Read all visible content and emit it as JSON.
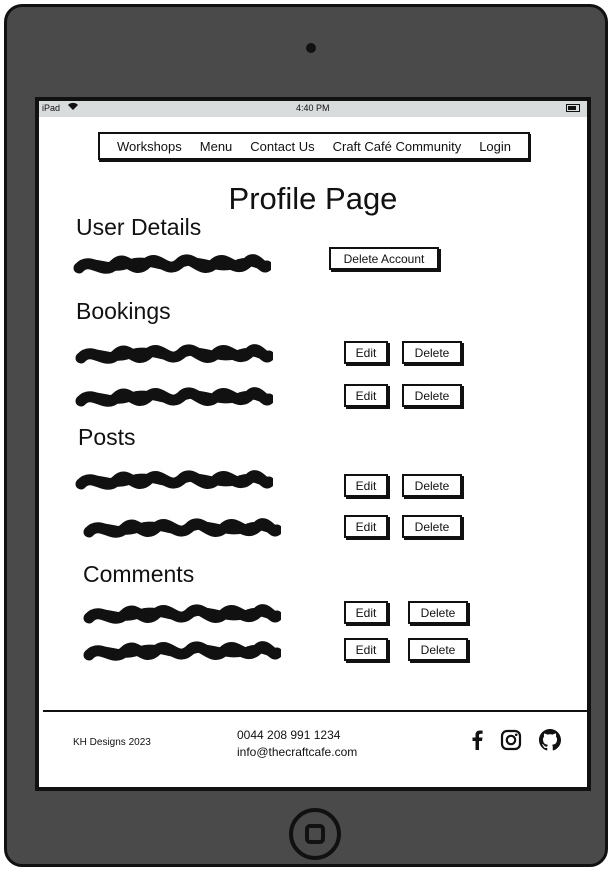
{
  "status_bar": {
    "carrier": "iPad",
    "time": "4:40 PM"
  },
  "nav": {
    "items": [
      "Workshops",
      "Menu",
      "Contact Us",
      "Craft Café Community",
      "Login"
    ]
  },
  "page": {
    "title": "Profile Page"
  },
  "user_details": {
    "heading": "User Details",
    "delete_account_label": "Delete Account"
  },
  "bookings": {
    "heading": "Bookings",
    "edit_label": "Edit",
    "delete_label": "Delete"
  },
  "posts": {
    "heading": "Posts",
    "edit_label": "Edit",
    "delete_label": "Delete"
  },
  "comments": {
    "heading": "Comments",
    "edit_label": "Edit",
    "delete_label": "Delete"
  },
  "footer": {
    "copyright": "KH Designs 2023",
    "phone": "0044 208 991 1234",
    "email": "info@thecraftcafe.com"
  },
  "icons": [
    "facebook-icon",
    "instagram-icon",
    "github-icon"
  ]
}
